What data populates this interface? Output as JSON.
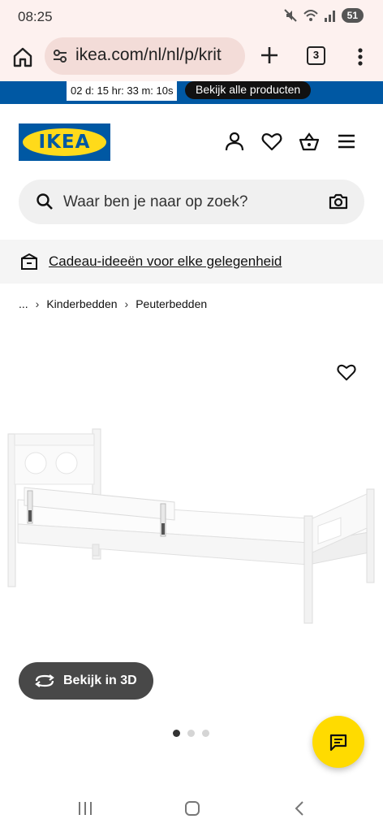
{
  "status_bar": {
    "time": "08:25",
    "battery": "51",
    "icons": [
      "mute-icon",
      "wifi-icon",
      "signal-icon"
    ]
  },
  "browser": {
    "url": "ikea.com/nl/nl/p/krit",
    "tab_count": "3",
    "icons": [
      "home-icon",
      "site-settings-icon",
      "plus-icon",
      "more-vert-icon"
    ]
  },
  "promo": {
    "countdown": "02 d: 15 hr: 33 m: 10s",
    "link_label": "Bekijk alle producten"
  },
  "header": {
    "logo_text": "IKEA",
    "icons": [
      "user-icon",
      "heart-icon",
      "basket-icon",
      "menu-icon"
    ]
  },
  "search": {
    "placeholder": "Waar ben je naar op zoek?"
  },
  "gift_banner": {
    "label": "Cadeau-ideeën voor elke gelegenheid"
  },
  "breadcrumb": {
    "items": [
      "...",
      "Kinderbedden",
      "Peuterbedden"
    ]
  },
  "product": {
    "view_3d_label": "Bekijk in 3D",
    "image_count": 3,
    "active_image": 1
  },
  "colors": {
    "ikea_blue": "#0058a3",
    "ikea_yellow": "#ffdb00",
    "browser_bg": "#fdf1ef"
  }
}
